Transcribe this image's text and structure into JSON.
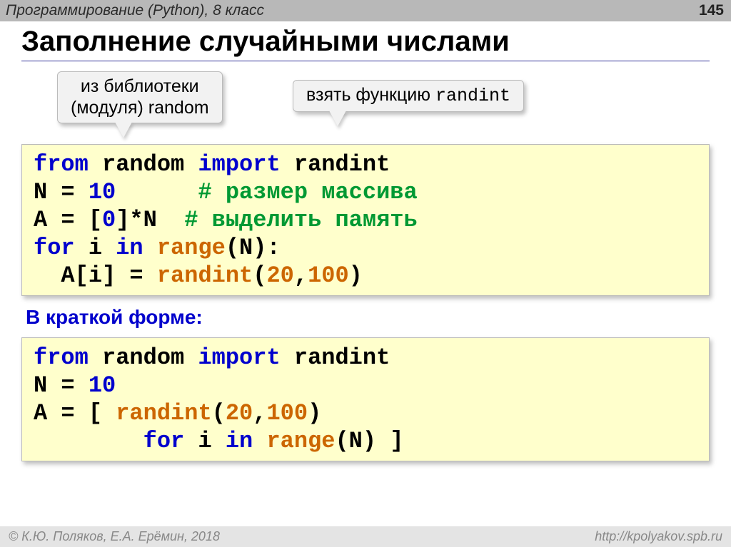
{
  "header": {
    "course": "Программирование (Python), 8 класс",
    "page": "145"
  },
  "title": "Заполнение случайными числами",
  "callouts": {
    "left_line1": "из библиотеки",
    "left_line2": "(модуля) random",
    "right_prefix": "взять функцию ",
    "right_fn": "randint"
  },
  "code1": {
    "l1_kw1": "from",
    "l1_mod": " random ",
    "l1_kw2": "import",
    "l1_fn": " randint",
    "l2_pre": "N = ",
    "l2_num": "10",
    "l2_sp": "      ",
    "l2_cmt": "# размер массива",
    "l3_pre": "A = [",
    "l3_num": "0",
    "l3_post": "]*N  ",
    "l3_cmt": "# выделить память",
    "l4_kw1": "for",
    "l4_mid": " i ",
    "l4_kw2": "in",
    "l4_sp": " ",
    "l4_fn": "range",
    "l4_end": "(N):",
    "l5_pre": "  A[i] = ",
    "l5_fn": "randint",
    "l5_lp": "(",
    "l5_a": "20",
    "l5_c": ",",
    "l5_b": "100",
    "l5_rp": ")"
  },
  "subhead": "В краткой форме:",
  "code2": {
    "l1_kw1": "from",
    "l1_mod": " random ",
    "l1_kw2": "import",
    "l1_fn": " randint",
    "l2_pre": "N = ",
    "l2_num": "10",
    "l3_pre": "A = [ ",
    "l3_fn": "randint",
    "l3_lp": "(",
    "l3_a": "20",
    "l3_c": ",",
    "l3_b": "100",
    "l3_rp": ")",
    "l4_sp": "        ",
    "l4_kw1": "for",
    "l4_mid": " i ",
    "l4_kw2": "in",
    "l4_sp2": " ",
    "l4_fn": "range",
    "l4_end": "(N) ]"
  },
  "footer": {
    "left": "© К.Ю. Поляков, Е.А. Ерёмин, 2018",
    "right": "http://kpolyakov.spb.ru"
  }
}
